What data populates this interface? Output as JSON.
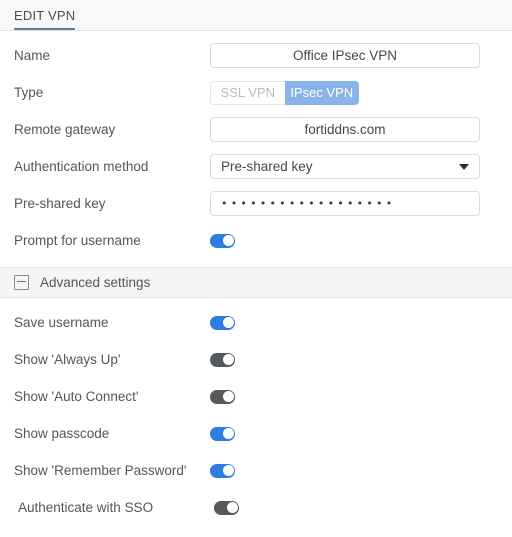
{
  "tab": {
    "label": "EDIT VPN"
  },
  "colors": {
    "accent_blue": "#2e7de0",
    "segment_selected_blue": "#8ab4e8",
    "toggle_off_gray": "#56595c",
    "tab_underline": "#5b7f9e",
    "band_background": "#f4f5f6"
  },
  "form": {
    "rows": [
      {
        "label": "Name",
        "value": "Office IPsec VPN",
        "type": "text"
      },
      {
        "label": "Type",
        "type": "segmented"
      },
      {
        "label": "Remote gateway",
        "value": "fortiddns.com",
        "type": "text"
      },
      {
        "label": "Authentication method",
        "value": "Pre-shared key",
        "type": "select"
      },
      {
        "label": "Pre-shared key",
        "value": "••••••••••••••••••",
        "type": "password"
      },
      {
        "label": "Prompt for username",
        "type": "toggle",
        "state": "on"
      }
    ],
    "segmented": {
      "options": [
        "SSL VPN",
        "IPsec VPN"
      ],
      "selected": "IPsec VPN"
    },
    "select_options": [
      "Pre-shared key"
    ]
  },
  "advanced": {
    "title": "Advanced settings",
    "collapse_icon": "minus-square-icon",
    "expanded": true,
    "rows": [
      {
        "label": "Save username",
        "state": "on"
      },
      {
        "label": "Show 'Always Up'",
        "state": "off"
      },
      {
        "label": "Show 'Auto Connect'",
        "state": "off"
      },
      {
        "label": "Show passcode",
        "state": "on"
      },
      {
        "label": "Show 'Remember Password'",
        "state": "on"
      },
      {
        "label": "Authenticate with SSO",
        "state": "off"
      }
    ]
  }
}
